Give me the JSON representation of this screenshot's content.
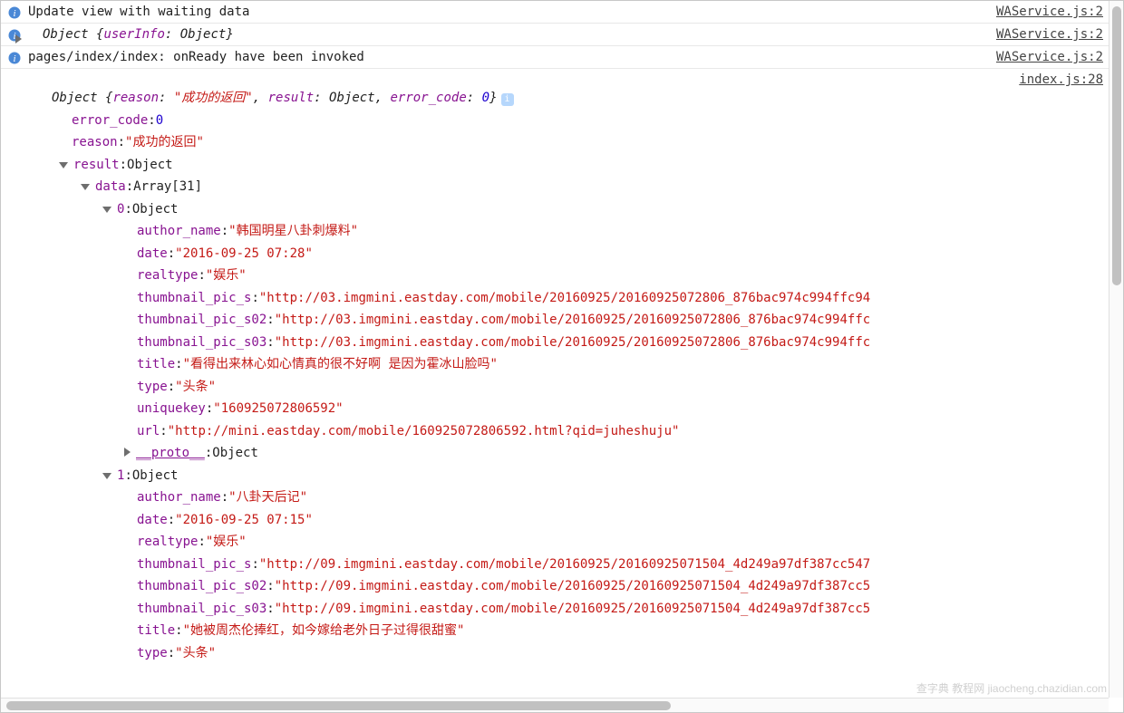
{
  "logs": [
    {
      "icon": "info",
      "text": "Update view with waiting data",
      "source": "WAService.js:2"
    },
    {
      "icon": "info",
      "caret": "right",
      "summaryPrefix": "Object {",
      "summaryKey": "userInfo",
      "summaryType": "Object",
      "summarySuffix": "}",
      "source": "WAService.js:2",
      "isObjectSummary": true
    },
    {
      "icon": "info",
      "text": "pages/index/index: onReady have been invoked",
      "source": "WAService.js:2"
    }
  ],
  "detailSource": "index.js:28",
  "objectSummary": {
    "prefix": "Object {",
    "suffix": "}",
    "parts": [
      {
        "k": "reason",
        "t": "str",
        "v": "\"成功的返回\""
      },
      {
        "k": "result",
        "t": "type",
        "v": "Object"
      },
      {
        "k": "error_code",
        "t": "num",
        "v": "0"
      }
    ]
  },
  "tree": [
    {
      "indent": 1,
      "key": "error_code",
      "type": "num",
      "value": "0"
    },
    {
      "indent": 1,
      "key": "reason",
      "type": "str",
      "value": "\"成功的返回\""
    },
    {
      "indent": 1,
      "caret": "down",
      "key": "result",
      "type": "type",
      "value": "Object"
    },
    {
      "indent": 2,
      "caret": "down",
      "key": "data",
      "type": "type",
      "value": "Array[31]"
    },
    {
      "indent": 3,
      "caret": "down",
      "key": "0",
      "type": "type",
      "value": "Object"
    },
    {
      "indent": 4,
      "key": "author_name",
      "type": "str",
      "value": "\"韩国明星八卦刺爆料\""
    },
    {
      "indent": 4,
      "key": "date",
      "type": "str",
      "value": "\"2016-09-25 07:28\""
    },
    {
      "indent": 4,
      "key": "realtype",
      "type": "str",
      "value": "\"娱乐\""
    },
    {
      "indent": 4,
      "key": "thumbnail_pic_s",
      "type": "str",
      "value": "\"http://03.imgmini.eastday.com/mobile/20160925/20160925072806_876bac974c994ffc94"
    },
    {
      "indent": 4,
      "key": "thumbnail_pic_s02",
      "type": "str",
      "value": "\"http://03.imgmini.eastday.com/mobile/20160925/20160925072806_876bac974c994ffc"
    },
    {
      "indent": 4,
      "key": "thumbnail_pic_s03",
      "type": "str",
      "value": "\"http://03.imgmini.eastday.com/mobile/20160925/20160925072806_876bac974c994ffc"
    },
    {
      "indent": 4,
      "key": "title",
      "type": "str",
      "value": "\"看得出来林心如心情真的很不好啊 是因为霍冰山脸吗\""
    },
    {
      "indent": 4,
      "key": "type",
      "type": "str",
      "value": "\"头条\""
    },
    {
      "indent": 4,
      "key": "uniquekey",
      "type": "str",
      "value": "\"160925072806592\""
    },
    {
      "indent": 4,
      "key": "url",
      "type": "str",
      "value": "\"http://mini.eastday.com/mobile/160925072806592.html?qid=juheshuju\""
    },
    {
      "indent": 4,
      "caret": "right",
      "proto": true,
      "key": "__proto__",
      "type": "type",
      "value": "Object"
    },
    {
      "indent": 3,
      "caret": "down",
      "key": "1",
      "type": "type",
      "value": "Object"
    },
    {
      "indent": 4,
      "key": "author_name",
      "type": "str",
      "value": "\"八卦天后记\""
    },
    {
      "indent": 4,
      "key": "date",
      "type": "str",
      "value": "\"2016-09-25 07:15\""
    },
    {
      "indent": 4,
      "key": "realtype",
      "type": "str",
      "value": "\"娱乐\""
    },
    {
      "indent": 4,
      "key": "thumbnail_pic_s",
      "type": "str",
      "value": "\"http://09.imgmini.eastday.com/mobile/20160925/20160925071504_4d249a97df387cc547"
    },
    {
      "indent": 4,
      "key": "thumbnail_pic_s02",
      "type": "str",
      "value": "\"http://09.imgmini.eastday.com/mobile/20160925/20160925071504_4d249a97df387cc5"
    },
    {
      "indent": 4,
      "key": "thumbnail_pic_s03",
      "type": "str",
      "value": "\"http://09.imgmini.eastday.com/mobile/20160925/20160925071504_4d249a97df387cc5"
    },
    {
      "indent": 4,
      "key": "title",
      "type": "str",
      "value": "\"她被周杰伦捧红，如今嫁给老外日子过得很甜蜜\""
    },
    {
      "indent": 4,
      "key": "type",
      "type": "str",
      "value": "\"头条\""
    }
  ],
  "watermark": "查字典 教程网\njiaocheng.chazidian.com"
}
